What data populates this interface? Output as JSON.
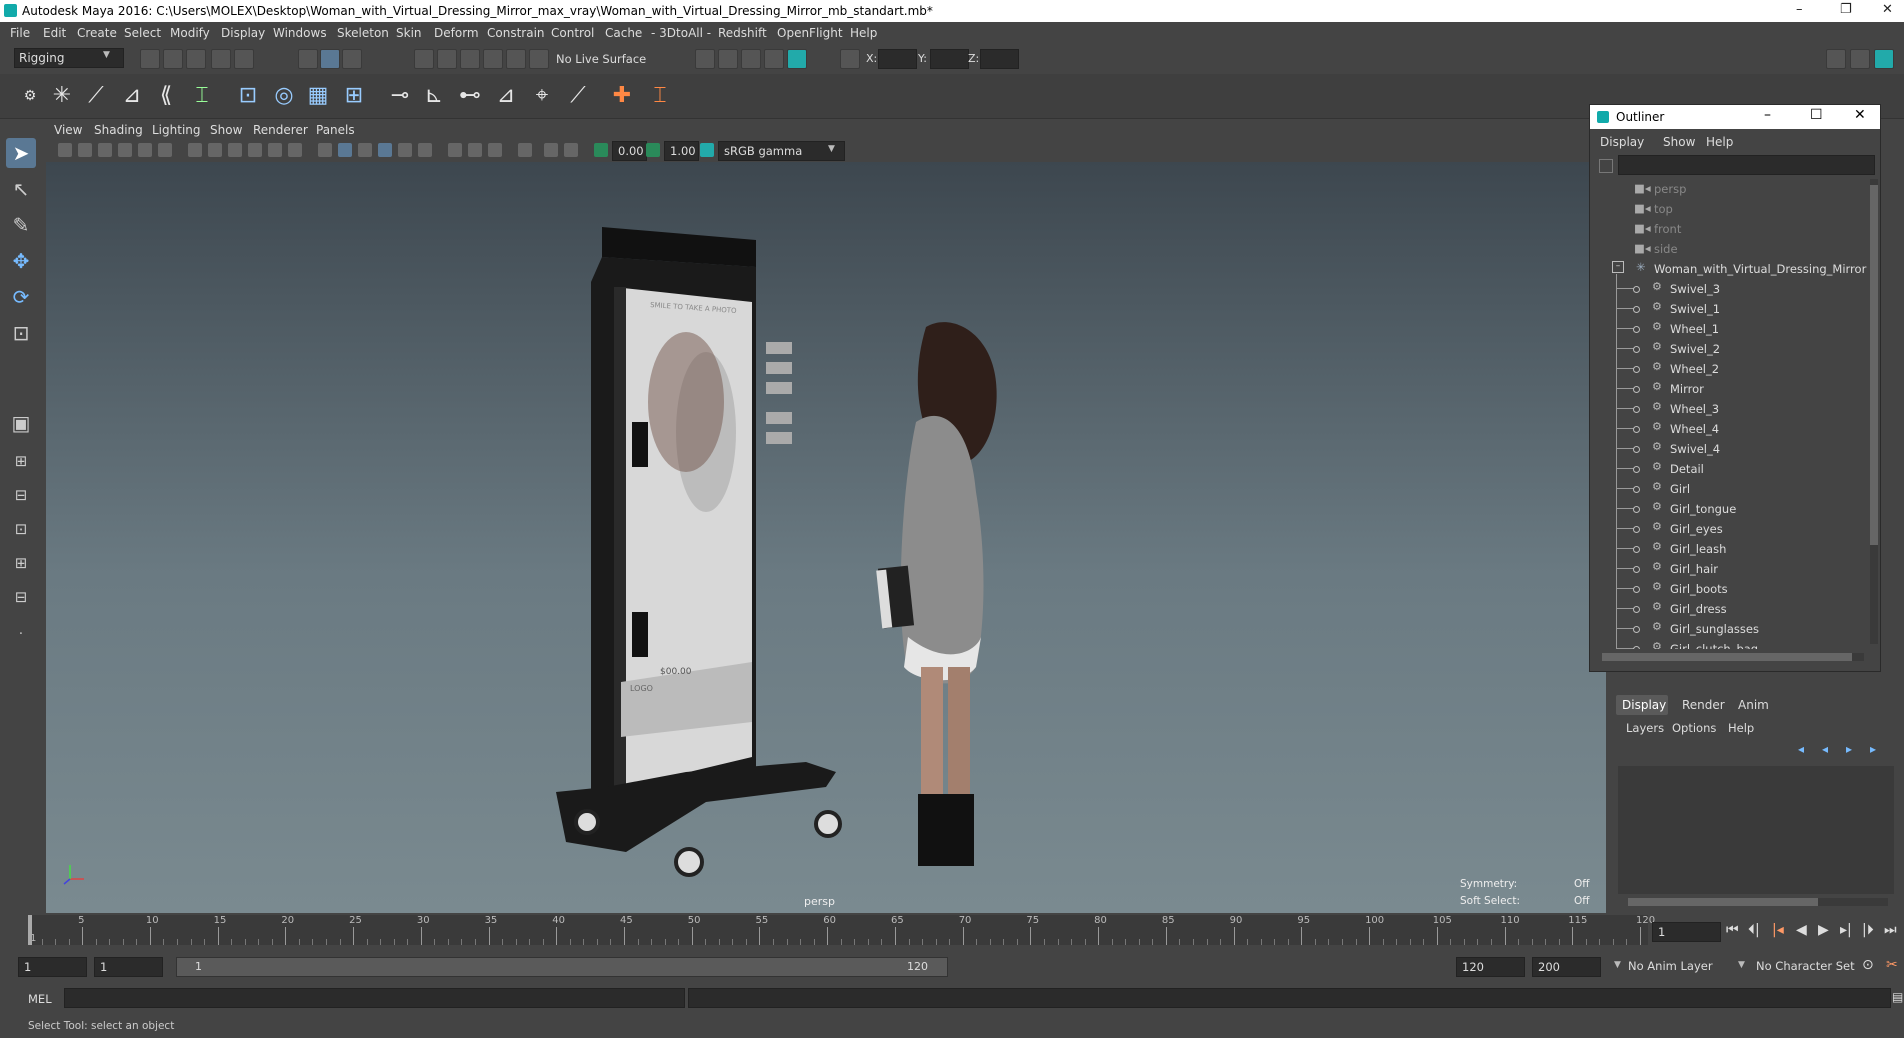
{
  "titlebar": {
    "title": "Autodesk Maya 2016: C:\\Users\\MOLEX\\Desktop\\Woman_with_Virtual_Dressing_Mirror_max_vray\\Woman_with_Virtual_Dressing_Mirror_mb_standart.mb*",
    "minimize": "–",
    "restore": "❐",
    "close": "✕"
  },
  "menubar": [
    "File",
    "Edit",
    "Create",
    "Select",
    "Modify",
    "Display",
    "Windows",
    "Skeleton",
    "Skin",
    "Deform",
    "Constrain",
    "Control",
    "Cache",
    "- 3DtoAll -",
    "Redshift",
    "OpenFlight",
    "Help"
  ],
  "statusline": {
    "mode": "Rigging",
    "live_surface": "No Live Surface",
    "x_label": "X:",
    "y_label": "Y:",
    "z_label": "Z:"
  },
  "panel": {
    "menus": [
      "View",
      "Shading",
      "Lighting",
      "Show",
      "Renderer",
      "Panels"
    ],
    "exposure": "0.00",
    "gamma": "1.00",
    "color_space": "sRGB gamma"
  },
  "viewport": {
    "camera_label": "persp",
    "symmetry_label": "Symmetry:",
    "symmetry_value": "Off",
    "soft_select_label": "Soft Select:",
    "soft_select_value": "Off",
    "mirror_screen": {
      "header": "SMILE TO TAKE A PHOTO",
      "price": "$00.00",
      "logo": "LOGO"
    }
  },
  "outliner": {
    "title": "Outliner",
    "menus": [
      "Display",
      "Show",
      "Help"
    ],
    "cameras": [
      "persp",
      "top",
      "front",
      "side"
    ],
    "root": "Woman_with_Virtual_Dressing_Mirror",
    "children": [
      "Swivel_3",
      "Swivel_1",
      "Wheel_1",
      "Swivel_2",
      "Wheel_2",
      "Mirror",
      "Wheel_3",
      "Wheel_4",
      "Swivel_4",
      "Detail",
      "Girl",
      "Girl_tongue",
      "Girl_eyes",
      "Girl_leash",
      "Girl_hair",
      "Girl_boots",
      "Girl_dress",
      "Girl_sunglasses",
      "Girl_clutch_bag"
    ]
  },
  "channelbox": {
    "tabs": [
      "Display",
      "Render",
      "Anim"
    ],
    "menus": [
      "Layers",
      "Options",
      "Help"
    ]
  },
  "timeslider": {
    "ticks": [
      "1",
      "5",
      "10",
      "15",
      "20",
      "25",
      "30",
      "35",
      "40",
      "45",
      "50",
      "55",
      "60",
      "65",
      "70",
      "75",
      "80",
      "85",
      "90",
      "95",
      "100",
      "105",
      "110",
      "115",
      "120"
    ],
    "current_frame": "1"
  },
  "rangeslider": {
    "start": "1",
    "start2": "1",
    "range_start": "1",
    "range_end": "120",
    "end": "120",
    "end2": "200",
    "anim_layer": "No Anim Layer",
    "char_set": "No Character Set"
  },
  "cmdline": {
    "label": "MEL"
  },
  "helpline": {
    "text": "Select Tool: select an object"
  }
}
